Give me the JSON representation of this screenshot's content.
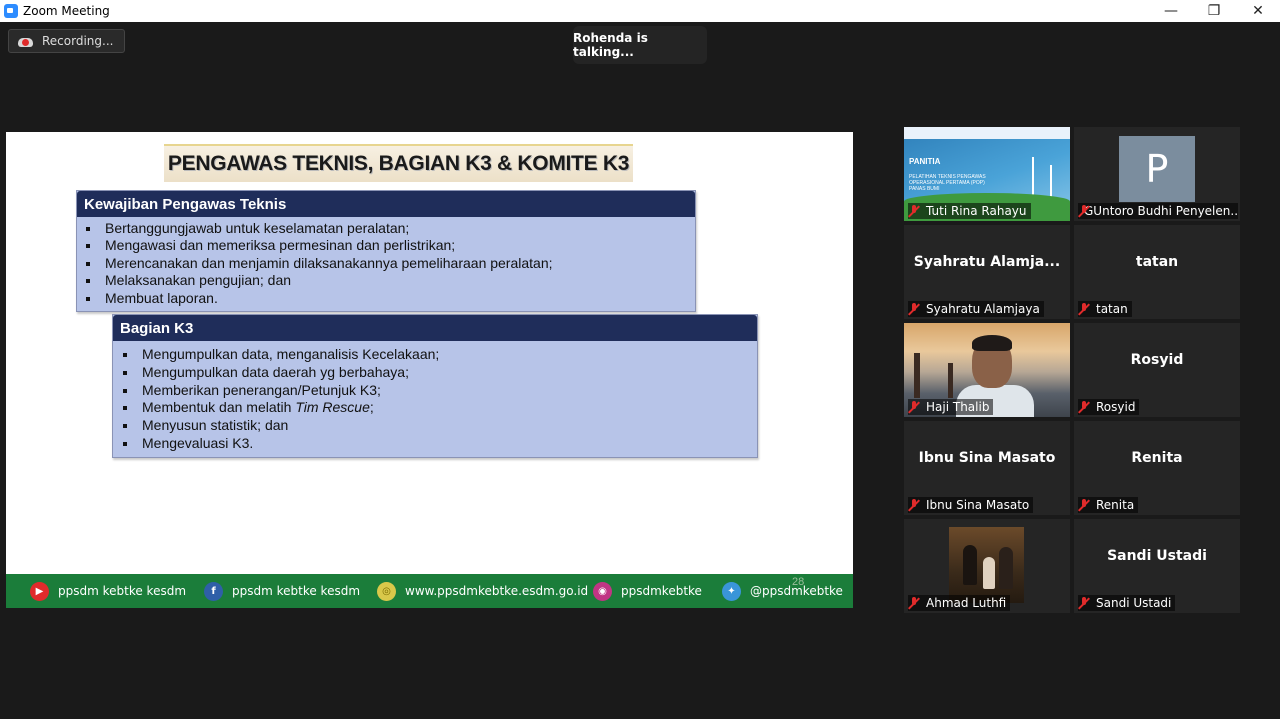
{
  "window": {
    "title": "Zoom Meeting",
    "min": "—",
    "max": "❐",
    "close": "✕"
  },
  "recording": "Recording...",
  "talking": "Rohenda is talking...",
  "slide": {
    "title": "PENGAWAS TEKNIS, BAGIAN K3 & KOMITE K3",
    "box1": {
      "heading": "Kewajiban Pengawas Teknis",
      "items": [
        "Bertanggungjawab untuk keselamatan peralatan;",
        "Mengawasi dan memeriksa permesinan dan perlistrikan;",
        "Merencanakan dan menjamin dilaksanakannya pemeliharaan peralatan;",
        "Melaksanakan pengujian; dan",
        "Membuat laporan."
      ]
    },
    "box2": {
      "heading": "Bagian K3",
      "items": [
        "Mengumpulkan data, menganalisis Kecelakaan;",
        "Mengumpulkan data daerah yg berbahaya;",
        "Memberikan penerangan/Petunjuk K3;",
        "Membentuk dan melatih ",
        "Menyusun statistik; dan",
        "Mengevaluasi K3."
      ],
      "italic_term": "Tim Rescue",
      "italic_suffix": ";"
    },
    "page_number": "28",
    "footer": [
      {
        "icon": "youtube-icon",
        "glyph": "▶",
        "text": "ppsdm kebtke kesdm"
      },
      {
        "icon": "facebook-icon",
        "glyph": "f",
        "text": "ppsdm kebtke kesdm"
      },
      {
        "icon": "web-icon",
        "glyph": "◎",
        "text": "www.ppsdmkebtke.esdm.go.id"
      },
      {
        "icon": "instagram-icon",
        "glyph": "◉",
        "text": "ppsdmkebtke"
      },
      {
        "icon": "twitter-icon",
        "glyph": "✦",
        "text": "@ppsdmkebtke"
      }
    ]
  },
  "participants": [
    {
      "label": "Tuti Rina Rahayu",
      "kind": "poster"
    },
    {
      "label": "GUntoro Budhi Penyelen...",
      "kind": "avatar",
      "avatar_letter": "P"
    },
    {
      "label": "Syahratu Alamjaya",
      "kind": "name",
      "big": "Syahratu  Alamja..."
    },
    {
      "label": "tatan",
      "kind": "name",
      "big": "tatan"
    },
    {
      "label": "Haji Thalib",
      "kind": "photo"
    },
    {
      "label": "Rosyid",
      "kind": "name",
      "big": "Rosyid"
    },
    {
      "label": "Ibnu Sina Masato",
      "kind": "name",
      "big": "Ibnu Sina Masato"
    },
    {
      "label": "Renita",
      "kind": "name",
      "big": "Renita"
    },
    {
      "label": "Ahmad Luthfi",
      "kind": "photo"
    },
    {
      "label": "Sandi Ustadi",
      "kind": "name",
      "big": "Sandi Ustadi"
    }
  ],
  "poster": {
    "title": "PANITIA",
    "subtitle": "PELATIHAN TEKNIS PENGAWAS OPERASIONAL PERTAMA (POP) PANAS BUMI"
  },
  "colors": {
    "footer_green": "#1b7d3a",
    "box_head": "#1f2d5a",
    "box_fill": "#b7c4e8",
    "mute_red": "#e02b2b"
  }
}
